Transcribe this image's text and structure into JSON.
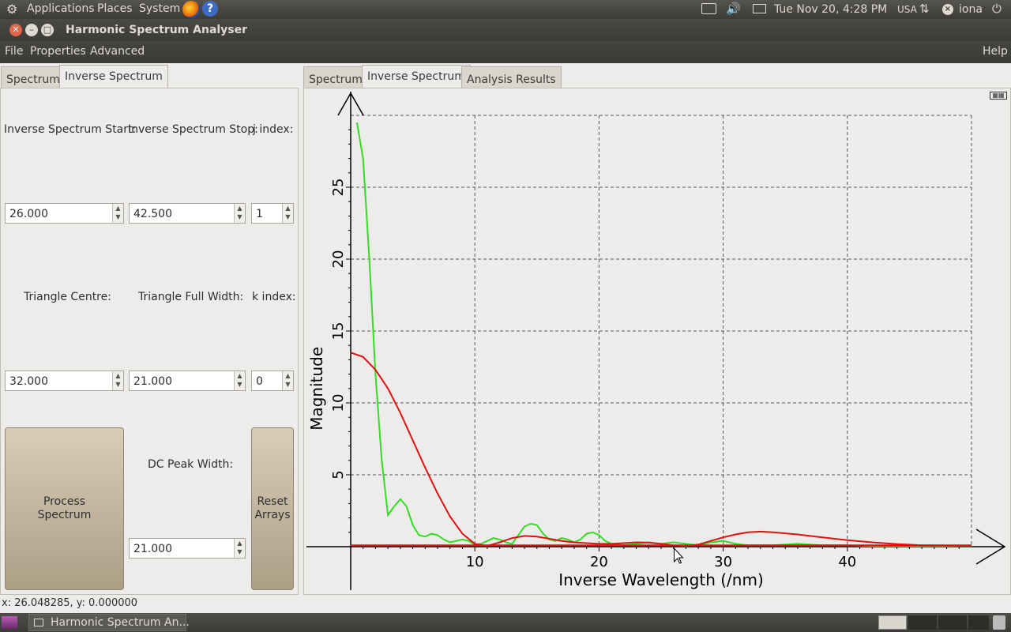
{
  "top_panel": {
    "menus": [
      "Applications",
      "Places",
      "System"
    ],
    "clock": "Tue Nov 20,  4:28 PM",
    "keyboard_layout": "USA",
    "user": "iona"
  },
  "window": {
    "title": "Harmonic Spectrum Analyser"
  },
  "menubar": {
    "items": [
      "File",
      "Properties",
      "Advanced"
    ],
    "help": "Help"
  },
  "left_panel": {
    "tabs": [
      "Spectrum",
      "Inverse Spectrum"
    ],
    "active_tab": 1,
    "inverse_start_label": "Inverse Spectrum Start:",
    "inverse_stop_label": "Inverse Spectrum Stop:",
    "j_index_label": "j index:",
    "inverse_start_value": "26.000",
    "inverse_stop_value": "42.500",
    "j_index_value": "1",
    "triangle_centre_label": "Triangle Centre:",
    "triangle_width_label": "Triangle Full Width:",
    "k_index_label": "k index:",
    "triangle_centre_value": "32.000",
    "triangle_width_value": "21.000",
    "k_index_value": "0",
    "process_button": "Process\nSpectrum",
    "dc_peak_label": "DC Peak Width:",
    "dc_peak_value": "21.000",
    "reset_button": "Reset\nArrays"
  },
  "right_panel": {
    "tabs": [
      "Spectrum",
      "Inverse Spectrum",
      "Analysis Results"
    ],
    "active_tab": 1
  },
  "chart_data": {
    "type": "line",
    "xlabel": "Inverse Wavelength (/nm)",
    "ylabel": "Magnitude",
    "xlim": [
      0,
      50
    ],
    "ylim": [
      -3,
      30
    ],
    "xticks": [
      10,
      20,
      30,
      40
    ],
    "yticks": [
      5,
      10,
      15,
      20,
      25
    ],
    "grid": true,
    "series": [
      {
        "color": "#33dd22",
        "x": [
          0.5,
          1.0,
          1.5,
          2.0,
          2.5,
          3.0,
          3.5,
          4.0,
          4.5,
          5.0,
          5.5,
          6.0,
          6.5,
          7.0,
          7.5,
          8.0,
          8.5,
          9.0,
          9.5,
          10.0,
          10.5,
          11.0,
          11.5,
          12.0,
          12.5,
          13.0,
          13.5,
          14.0,
          14.5,
          15.0,
          15.5,
          16.0,
          16.5,
          17.0,
          17.5,
          18.0,
          18.5,
          19.0,
          19.5,
          20.0,
          20.5,
          21.0,
          22.0,
          23.0,
          24.0,
          25.0,
          26.0,
          27.0,
          28.0,
          29.0,
          30.0,
          31.0,
          32.0,
          34.0,
          36.0,
          38.0,
          40.0,
          42.0,
          45.0,
          50.0
        ],
        "y": [
          29.5,
          27.0,
          20.0,
          12.0,
          6.0,
          2.2,
          2.8,
          3.3,
          2.8,
          1.5,
          0.8,
          0.7,
          0.9,
          0.8,
          0.5,
          0.3,
          0.4,
          0.5,
          0.4,
          0.15,
          0.2,
          0.4,
          0.6,
          0.5,
          0.3,
          0.2,
          0.8,
          1.4,
          1.6,
          1.5,
          0.9,
          0.5,
          0.4,
          0.6,
          0.5,
          0.3,
          0.5,
          0.9,
          1.0,
          0.8,
          0.4,
          0.2,
          0.1,
          0.2,
          0.3,
          0.2,
          0.3,
          0.2,
          0.1,
          0.3,
          0.4,
          0.2,
          0.1,
          0.1,
          0.2,
          0.1,
          0.1,
          0.05,
          0.05,
          0.05
        ]
      },
      {
        "color": "#dd1111",
        "x": [
          0.0,
          1.0,
          2.0,
          3.0,
          4.0,
          5.0,
          6.0,
          7.0,
          8.0,
          9.0,
          10.0,
          11.0,
          12.0,
          13.0,
          14.0,
          15.0,
          16.0,
          17.0,
          18.0,
          19.0,
          20.0,
          21.0,
          22.0,
          23.0,
          24.0,
          25.0,
          26.0,
          27.0,
          28.0,
          29.0,
          30.0,
          31.0,
          32.0,
          33.0,
          34.0,
          36.0,
          38.0,
          40.0,
          42.0,
          44.0,
          46.0,
          48.0,
          50.0
        ],
        "y": [
          13.5,
          13.2,
          12.3,
          11.0,
          9.3,
          7.4,
          5.5,
          3.7,
          2.1,
          0.9,
          0.2,
          0.05,
          0.3,
          0.6,
          0.75,
          0.7,
          0.55,
          0.4,
          0.3,
          0.25,
          0.2,
          0.2,
          0.25,
          0.3,
          0.28,
          0.2,
          0.1,
          0.05,
          0.15,
          0.4,
          0.65,
          0.85,
          1.0,
          1.05,
          1.0,
          0.85,
          0.65,
          0.45,
          0.3,
          0.18,
          0.1,
          0.08,
          0.05
        ]
      },
      {
        "color": "#dd1111",
        "x": [
          0.0,
          10.0,
          20.0,
          30.0,
          40.0,
          50.0
        ],
        "y": [
          0.1,
          0.1,
          0.1,
          0.1,
          0.1,
          0.1
        ]
      }
    ]
  },
  "status": {
    "coordinates": "x: 26.048285, y: 0.000000"
  },
  "taskbar": {
    "window_button": "Harmonic Spectrum An..."
  }
}
